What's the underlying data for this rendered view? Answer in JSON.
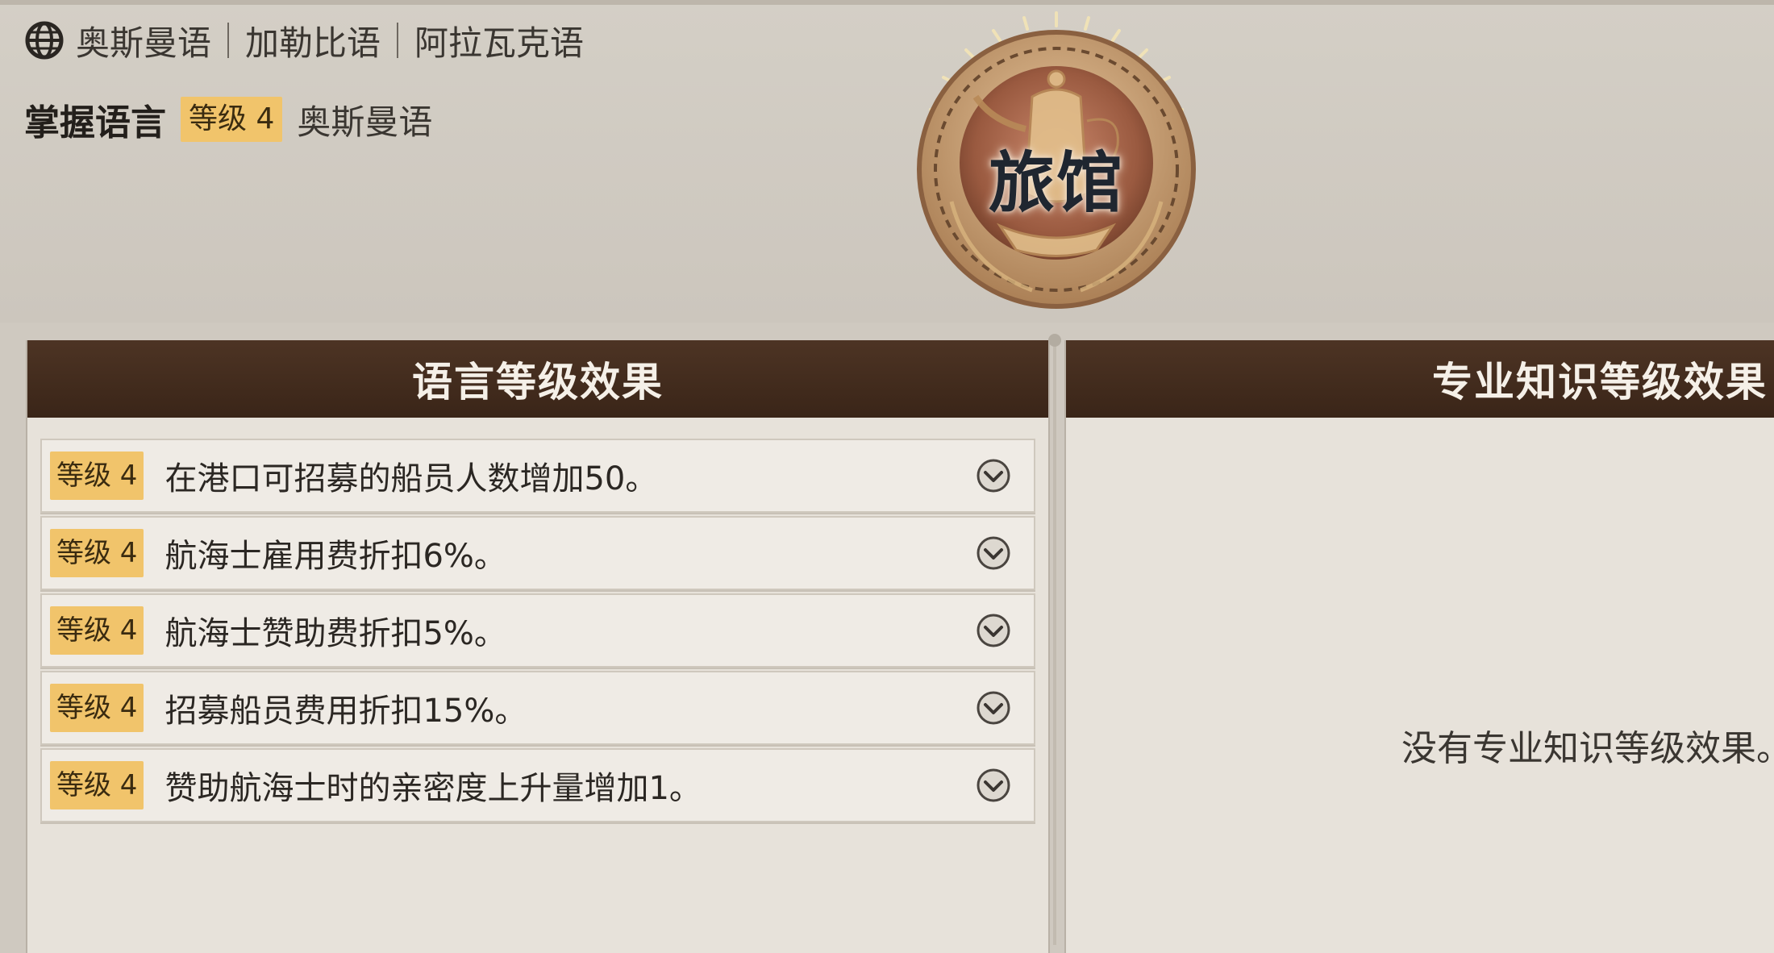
{
  "languages": {
    "items": [
      "奥斯曼语",
      "加勒比语",
      "阿拉瓦克语"
    ]
  },
  "mastery": {
    "title": "掌握语言",
    "level": "等级 4",
    "language": "奥斯曼语"
  },
  "emblem": {
    "label": "旅馆",
    "icon": "teapot-icon"
  },
  "left_panel": {
    "title": "语言等级效果",
    "effects": [
      {
        "level": "等级 4",
        "text": "在港口可招募的船员人数增加50。"
      },
      {
        "level": "等级 4",
        "text": "航海士雇用费折扣6%。"
      },
      {
        "level": "等级 4",
        "text": "航海士赞助费折扣5%。"
      },
      {
        "level": "等级 4",
        "text": "招募船员费用折扣15%。"
      },
      {
        "level": "等级 4",
        "text": "赞助航海士时的亲密度上升量增加1。"
      }
    ]
  },
  "right_panel": {
    "title": "专业知识等级效果",
    "empty_text": "没有专业知识等级效果。"
  },
  "colors": {
    "header_brown": "#3f2a1c",
    "level_badge": "#f1c46b",
    "panel_bg": "#e7e2da"
  }
}
